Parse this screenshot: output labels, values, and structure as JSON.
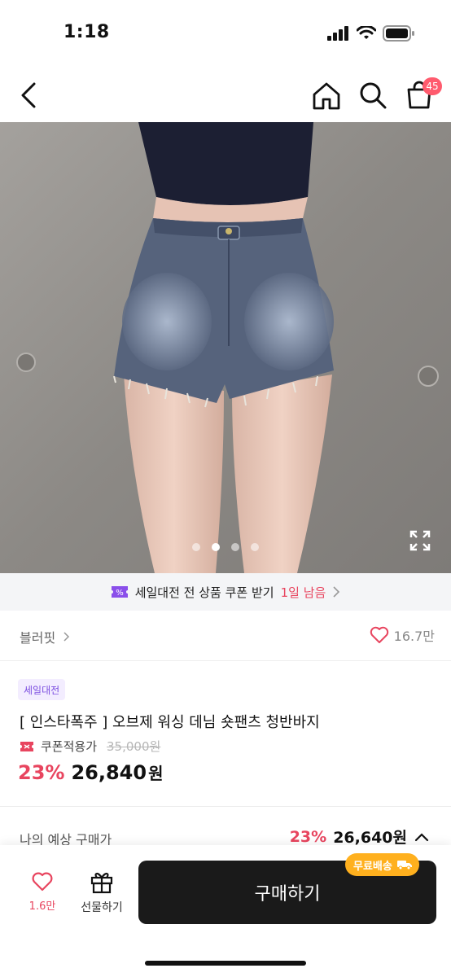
{
  "status_bar": {
    "time": "1:18",
    "icons": [
      "signal-icon",
      "wifi-icon",
      "battery-icon"
    ]
  },
  "nav": {
    "icons": [
      "back-icon",
      "home-icon",
      "search-icon",
      "cart-icon"
    ],
    "cart_badge": "45"
  },
  "image": {
    "slide_count": 4,
    "active_slide": 2,
    "expand_icon": "expand-icon"
  },
  "coupon_banner": {
    "text": "세일대전 전 상품 쿠폰 받기",
    "remaining": "1일 남음",
    "icon": "coupon-icon"
  },
  "brand": {
    "name": "블러핏",
    "like_count": "16.7만"
  },
  "product": {
    "sale_tag": "세일대전",
    "title": "[ 인스타폭주 ] 오브제 워싱 데님 숏팬츠 청반바지",
    "coupon_label": "쿠폰적용가",
    "original_price": "35,000원",
    "discount_rate": "23%",
    "price": "26,840",
    "price_unit": "원"
  },
  "expected_price": {
    "label": "나의 예상 구매가",
    "discount_rate": "23%",
    "price": "26,640원"
  },
  "bottom_bar": {
    "wish_count": "1.6만",
    "gift_label": "선물하기",
    "buy_label": "구매하기",
    "free_shipping": "무료배송"
  },
  "colors": {
    "accent": "#e8455f",
    "badge": "#ff5b6e",
    "sale_tag_text": "#7b4de0",
    "buy_button": "#1a1a1a",
    "free_shipping": "#ffb01e"
  }
}
